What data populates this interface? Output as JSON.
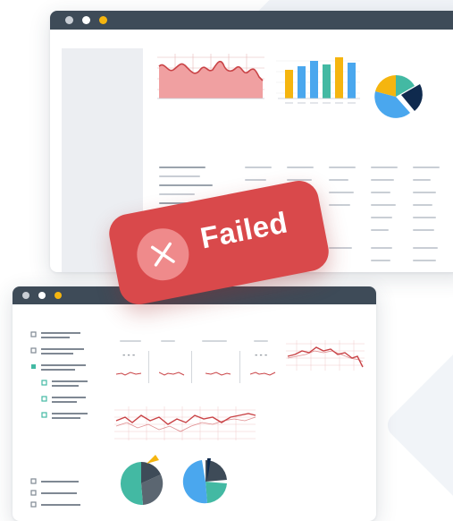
{
  "status": {
    "label": "Failed",
    "icon": "close-icon",
    "color": "#d9494b"
  },
  "colors": {
    "titlebar": "#3e4b58",
    "dot_gray": "#c9ced5",
    "dot_white": "#ffffff",
    "dot_yellow": "#f5b50f",
    "chart_red": "#c94346",
    "chart_red_fill": "#f0a0a1",
    "bar_yellow": "#f5b50f",
    "bar_blue": "#4aa7ee",
    "bar_teal": "#43b9a3",
    "pie_navy": "#0f2a4e"
  },
  "mini_panels": [
    {
      "value": "---"
    },
    {
      "value": ""
    },
    {
      "value": ""
    },
    {
      "value": "---"
    }
  ]
}
